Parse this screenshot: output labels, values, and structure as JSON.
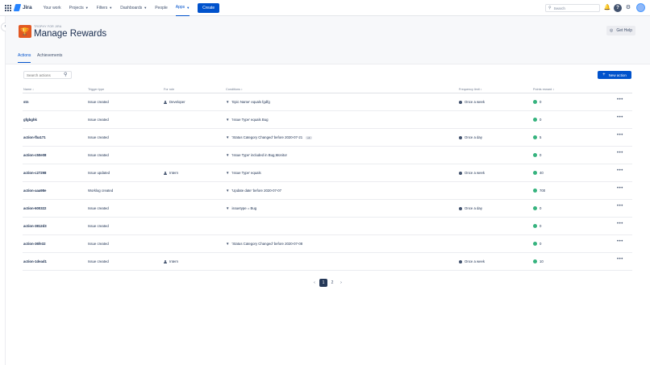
{
  "topnav": {
    "logo": "Jira",
    "items": [
      {
        "label": "Your work",
        "caret": false
      },
      {
        "label": "Projects",
        "caret": true
      },
      {
        "label": "Filters",
        "caret": true
      },
      {
        "label": "Dashboards",
        "caret": true
      },
      {
        "label": "People",
        "caret": false
      },
      {
        "label": "Apps",
        "caret": true,
        "active": true
      }
    ],
    "create_label": "Create",
    "search_placeholder": "Search"
  },
  "header": {
    "app_name": "TROPHY FOR JIRA",
    "title": "Manage Rewards",
    "help_label": "Get Help",
    "tabs": [
      "Actions",
      "Achievements"
    ]
  },
  "toolbar": {
    "search_placeholder": "Search actions",
    "new_action_label": "New action"
  },
  "table": {
    "columns": [
      "Name ↓",
      "Trigger type",
      "For role",
      "Conditions ↕",
      "Frequency limit ↕",
      "Points reward ↕"
    ],
    "rows": [
      {
        "name": "stn",
        "trigger": "Issue created",
        "role": "Developer",
        "condition": "'Epic Name' equals fgdfg",
        "extra": "",
        "frequency": "Once a week",
        "points": "0"
      },
      {
        "name": "gfgbghk",
        "trigger": "Issue created",
        "role": "",
        "condition": "'Issue Type' equals Bug",
        "extra": "",
        "frequency": "",
        "points": "0"
      },
      {
        "name": "action-fba171",
        "trigger": "Issue created",
        "role": "",
        "condition": "'Status Category Changed' before 2020-07-21",
        "extra": "+1",
        "frequency": "Once a day",
        "points": "5"
      },
      {
        "name": "action-c50e08",
        "trigger": "Issue created",
        "role": "",
        "condition": "'Issue Type' included in Bug,Monitor",
        "extra": "",
        "frequency": "",
        "points": "0"
      },
      {
        "name": "action-c27298",
        "trigger": "Issue updated",
        "role": "Intern",
        "condition": "'Issue Type' equals",
        "extra": "",
        "frequency": "Once a week",
        "points": "40"
      },
      {
        "name": "action-aaa98e",
        "trigger": "Worklog created",
        "role": "",
        "condition": "'Update date' before 2020-07-07",
        "extra": "",
        "frequency": "",
        "points": "700"
      },
      {
        "name": "action-600322",
        "trigger": "Issue created",
        "role": "",
        "condition": "issuetype = Bug",
        "extra": "",
        "frequency": "Once a day",
        "points": "0"
      },
      {
        "name": "action-3812d3",
        "trigger": "Issue created",
        "role": "",
        "condition": "",
        "extra": "",
        "frequency": "",
        "points": "0"
      },
      {
        "name": "action-36fe32",
        "trigger": "Issue created",
        "role": "",
        "condition": "'Status Category Changed' before 2020-07-08",
        "extra": "",
        "frequency": "",
        "points": "0"
      },
      {
        "name": "action-1dead1",
        "trigger": "Issue created",
        "role": "Intern",
        "condition": "",
        "extra": "",
        "frequency": "Once a week",
        "points": "10"
      }
    ],
    "more_glyph": "•••"
  },
  "pagination": {
    "prev": "‹",
    "pages": [
      "1",
      "2"
    ],
    "current": "1",
    "next": "›"
  }
}
